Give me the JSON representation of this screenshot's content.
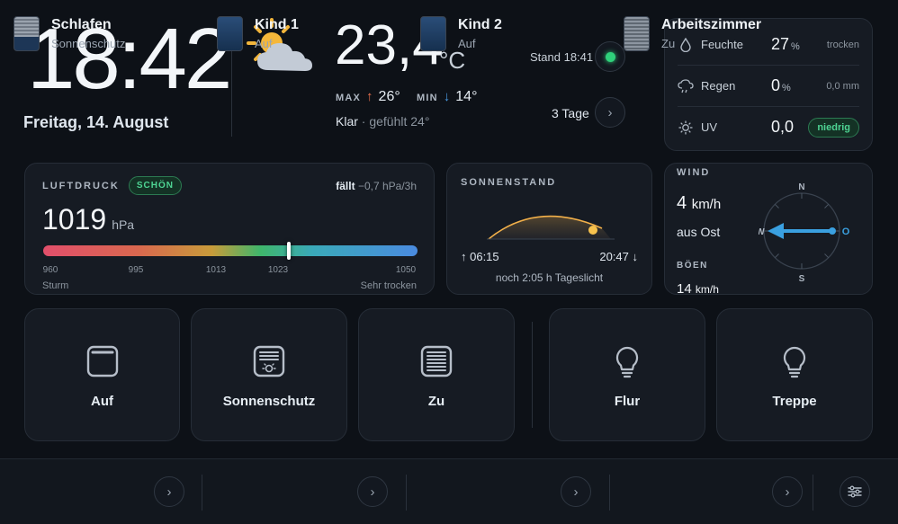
{
  "clock": {
    "time": "18:42",
    "date": "Freitag, 14. August"
  },
  "weather": {
    "icon": "sun-cloud-icon",
    "temperature": "23,4",
    "unit": "°C",
    "max_label": "MAX",
    "max_value": "26°",
    "min_label": "MIN",
    "min_value": "14°",
    "condition": "Klar",
    "feels_like": "· gefühlt 24°"
  },
  "status": {
    "stand_label": "Stand 18:41",
    "forecast_label": "3 Tage"
  },
  "metrics": [
    {
      "icon": "droplet-icon",
      "label": "Feuchte",
      "value": "27",
      "unit": "%",
      "note": "trocken"
    },
    {
      "icon": "rain-cloud-icon",
      "label": "Regen",
      "value": "0",
      "unit": "%",
      "note": "0,0 mm"
    },
    {
      "icon": "sun-icon",
      "label": "UV",
      "value": "0,0",
      "unit": "",
      "badge": "niedrig"
    }
  ],
  "pressure": {
    "title": "LUFTDRUCK",
    "badge": "SCHÖN",
    "trend_label": "fällt",
    "trend_value": "−0,7 hPa/3h",
    "value": "1019",
    "unit": "hPa",
    "scale_min": 960,
    "scale_max": 1050,
    "current": 1019,
    "ticks": [
      "960",
      "995",
      "1013",
      "1023",
      "1050"
    ],
    "low_label": "Sturm",
    "high_label": "Sehr trocken"
  },
  "sun": {
    "title": "SONNENSTAND",
    "sunrise": "↑ 06:15",
    "sunset": "20:47 ↓",
    "daylight": "noch 2:05 h Tageslicht",
    "day_progress": 0.85
  },
  "wind": {
    "title": "WIND",
    "speed": "4",
    "speed_unit": "km/h",
    "direction": "aus Ost",
    "compass": {
      "n": "N",
      "o": "O",
      "s": "S",
      "w": "W"
    },
    "gust_label": "BÖEN",
    "gust_value": "14",
    "gust_unit": "km/h"
  },
  "scenes": [
    {
      "icon": "blind-open-icon",
      "label": "Auf"
    },
    {
      "icon": "blind-sunshade-icon",
      "label": "Sonnenschutz"
    },
    {
      "icon": "blind-closed-icon",
      "label": "Zu"
    },
    {
      "icon": "lightbulb-icon",
      "label": "Flur"
    },
    {
      "icon": "lightbulb-icon",
      "label": "Treppe"
    }
  ],
  "rooms": [
    {
      "name": "Schlafen",
      "state": "Sonnenschutz"
    },
    {
      "name": "Kind 1",
      "state": "Auf"
    },
    {
      "name": "Kind 2",
      "state": "Auf"
    },
    {
      "name": "Arbeitszimmer",
      "state": "Zu"
    }
  ],
  "colors": {
    "accent_green": "#2fd07a",
    "wind_arrow": "#3aa0e0",
    "sun_arc": "#f2b04a"
  }
}
